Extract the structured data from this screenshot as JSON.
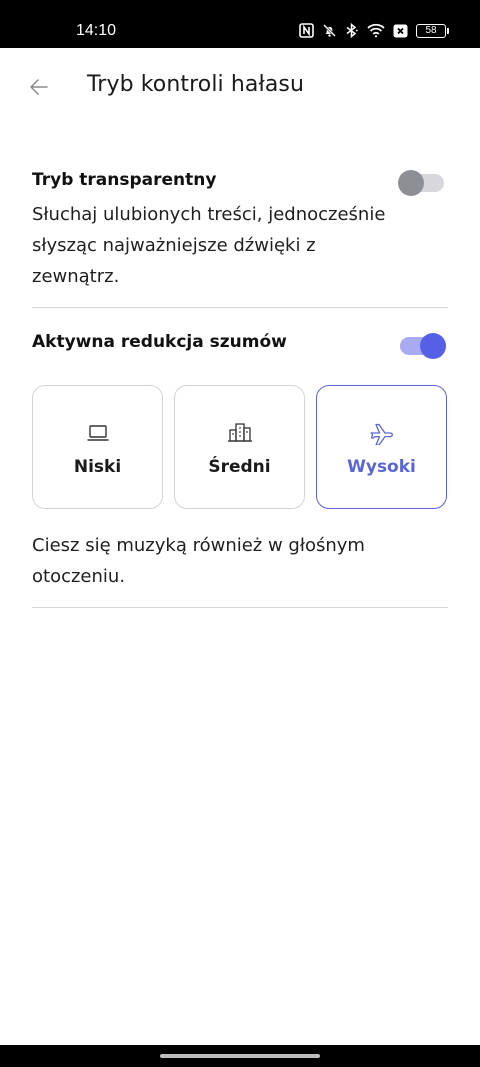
{
  "status_bar": {
    "time": "14:10",
    "battery": "58",
    "icons": [
      "nfc-icon",
      "bell-off-icon",
      "bluetooth-icon",
      "wifi-icon",
      "close-box-icon",
      "battery-icon"
    ]
  },
  "header": {
    "title": "Tryb kontroli hałasu",
    "back_icon": "arrow-left-icon"
  },
  "transparent_mode": {
    "label": "Tryb transparentny",
    "enabled": false,
    "description_lines": [
      "Słuchaj ulubionych treści, jednocześnie",
      "słysząc najważniejsze dźwięki z",
      "zewnątrz."
    ]
  },
  "anc": {
    "label": "Aktywna redukcja szumów",
    "enabled": true,
    "modes": [
      {
        "label": "Niski",
        "icon": "laptop-icon",
        "selected": false
      },
      {
        "label": "Średni",
        "icon": "buildings-icon",
        "selected": false
      },
      {
        "label": "Wysoki",
        "icon": "airplane-icon",
        "selected": true
      }
    ],
    "description_lines": [
      "Ciesz się muzyką również w głośnym",
      "otoczeniu."
    ]
  },
  "colors": {
    "accent": "#5b66d6",
    "toggle_on_thumb": "#5560e6",
    "toggle_on_track": "#a9abf2",
    "toggle_off_thumb": "#8e8e96",
    "toggle_off_track": "#d8d8dc"
  }
}
